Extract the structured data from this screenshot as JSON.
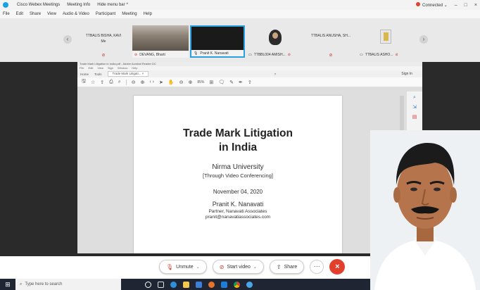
{
  "titlebar": {
    "app_title": "Cisco Webex Meetings",
    "meeting_info": "Meeting Info",
    "hide_menu_bar": "Hide menu bar ^",
    "status": "Connected",
    "minimize": "–",
    "restore": "□",
    "close": "×"
  },
  "menubar": {
    "items": [
      "File",
      "Edit",
      "Share",
      "View",
      "Audio & Video",
      "Participant",
      "Meeting",
      "Help"
    ]
  },
  "participants": {
    "tiles": [
      {
        "name": "TTBALIS BISHA, KAVI",
        "sub": "Me"
      },
      {
        "name": "DEVANG, Bharti"
      },
      {
        "name": "Pranit K. Nanavati"
      },
      {
        "name": "TTBBL004 AMISH..."
      },
      {
        "name": "TTBALIS ANUSHA, SH..."
      },
      {
        "name": "TTBALIS ASHO..."
      }
    ],
    "nav_left": "‹",
    "nav_right": "›"
  },
  "shared_window": {
    "title": "Trade Mark Litigation in India.pdf - Adobe Acrobat Reader DC",
    "menu": [
      "File",
      "Edit",
      "View",
      "Sign",
      "Window",
      "Help"
    ],
    "tabs": [
      "Home",
      "Tools",
      "Trade Mark Litigati... ×"
    ],
    "sign_in": "Sign In",
    "zoom": "85%"
  },
  "pdf": {
    "title_line1": "Trade Mark Litigation",
    "title_line2": "in India",
    "university": "Nirma University",
    "mode": "[Through Video Conferencing]",
    "date": "November 04, 2020",
    "presenter": "Pranit K. Nanavati",
    "role": "Partner, Nanavati Associates",
    "email": "pranit@nanavatiassociates.com"
  },
  "controls": {
    "unmute": "Unmute",
    "start_video": "Start video",
    "share": "Share",
    "more": "···",
    "leave": "×"
  },
  "taskbar": {
    "search_placeholder": "Type here to search"
  },
  "colors": {
    "webex_blue": "#1aa1e1",
    "leave_red": "#e2402c",
    "stage_dark": "#2a2a2a",
    "taskbar": "#1f2533"
  }
}
